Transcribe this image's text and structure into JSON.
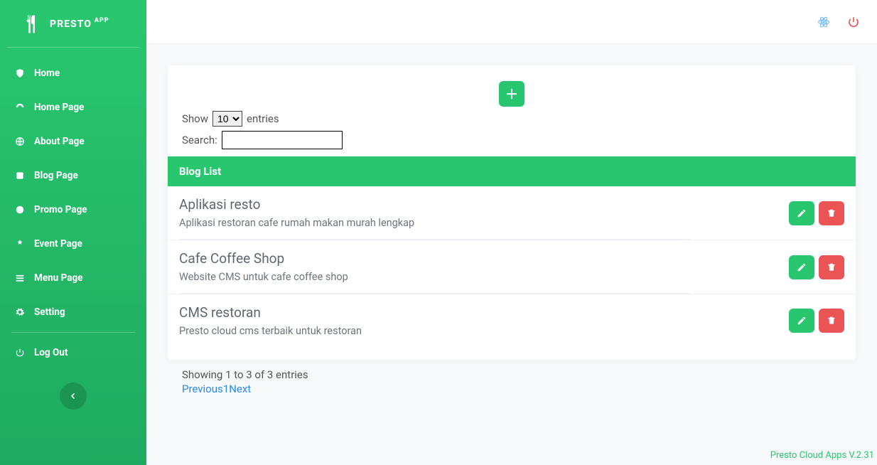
{
  "brand": {
    "name": "PRESTO",
    "suffix": "APP"
  },
  "sidebar": {
    "items": [
      {
        "icon": "shield-icon",
        "label": "Home"
      },
      {
        "icon": "dashboard-icon",
        "label": "Home Page"
      },
      {
        "icon": "globe-icon",
        "label": "About Page"
      },
      {
        "icon": "blog-icon",
        "label": "Blog Page"
      },
      {
        "icon": "promo-icon",
        "label": "Promo Page"
      },
      {
        "icon": "event-icon",
        "label": "Event Page"
      },
      {
        "icon": "menu-icon",
        "label": "Menu Page"
      },
      {
        "icon": "gear-icon",
        "label": "Setting"
      }
    ],
    "logout": {
      "label": "Log Out"
    }
  },
  "topbar": {
    "atom_color": "#7cbef6",
    "power_color": "#ea5455"
  },
  "datatable": {
    "show_label_pre": "Show",
    "show_label_post": "entries",
    "length_value": "10",
    "length_options": [
      "10"
    ],
    "search_label": "Search:",
    "search_value": ""
  },
  "list": {
    "header": "Blog List",
    "rows": [
      {
        "title": "Aplikasi resto",
        "subtitle": "Aplikasi restoran cafe rumah makan murah lengkap"
      },
      {
        "title": "Cafe Coffee Shop",
        "subtitle": "Website CMS untuk cafe coffee shop"
      },
      {
        "title": "CMS restoran",
        "subtitle": "Presto cloud cms terbaik untuk restoran"
      }
    ]
  },
  "info_text": "Showing 1 to 3 of 3 entries",
  "paginate": {
    "prev": "Previous",
    "page": "1",
    "next": "Next"
  },
  "footer": "Presto Cloud Apps V.2.31",
  "colors": {
    "green": "#28c76f",
    "red": "#ea5455"
  }
}
